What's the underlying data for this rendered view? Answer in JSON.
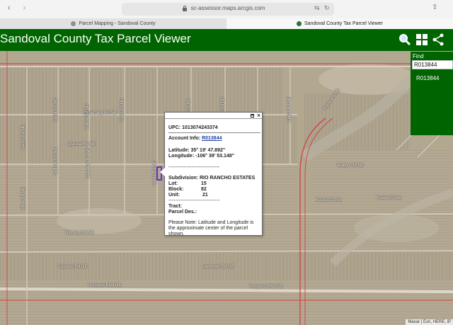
{
  "browser": {
    "url": "sc-assessor.maps.arcgis.com",
    "tabs": [
      {
        "label": "Parcel Mapping - Sandoval County"
      },
      {
        "label": "Sandoval County Tax Parcel Viewer"
      }
    ]
  },
  "app": {
    "title": "Sandoval County Tax Parcel Viewer",
    "toolbar_icons": [
      "search-icon",
      "grid-icon",
      "share-icon"
    ],
    "colors": {
      "header_bg": "#006400",
      "selection": "#6b2fcf"
    }
  },
  "find": {
    "label": "Find",
    "input_value": "R013844",
    "result": "R013844"
  },
  "popup": {
    "upc_label": "UPC:",
    "upc_value": "1013074243374",
    "account_label": "Account Info:",
    "account_value": "R013844",
    "latitude_label": "Latitude:",
    "latitude_value": "35° 19' 47.892\"",
    "longitude_label": "Longitude:",
    "longitude_value": "-106° 39' 53.148\"",
    "separator": "-------------------------------",
    "subdivision_label": "Subdivision:",
    "subdivision_value": "RIO RANCHO ESTATES",
    "lot_label": "Lot:",
    "lot_value": "15",
    "block_label": "Block:",
    "block_value": "82",
    "unit_label": "Unit:",
    "unit_value": "21",
    "tract_label": "Tract:",
    "parcel_des_label": "Parcel Des.:",
    "note": "Please Note: Latitude and Longitude is the approximate center of the parcel shown."
  },
  "map": {
    "streets": [
      "Rosemary Rd NE",
      "Quinoa Rd NE",
      "Nutmeg Rd NE",
      "Cypress Rd NE",
      "Lavender Rd NE",
      "Progress Blvd NE",
      "Koala Rd NE",
      "Walton Rd NE",
      "Kestrel Ct NE",
      "Yazoo Rd NE",
      "Idalia Rd NE",
      "Zebra Rd NE",
      "Cielo Rd NE",
      "Verde Rd NE",
      "Volta Rd NE",
      "Ridge Rd NE",
      "Zebra Rd NE",
      "Saffron Rd NE",
      "Caraway Rd NE",
      "Olive Rd NE"
    ],
    "attribution": "Maxar | Esri, HERE, iP"
  }
}
